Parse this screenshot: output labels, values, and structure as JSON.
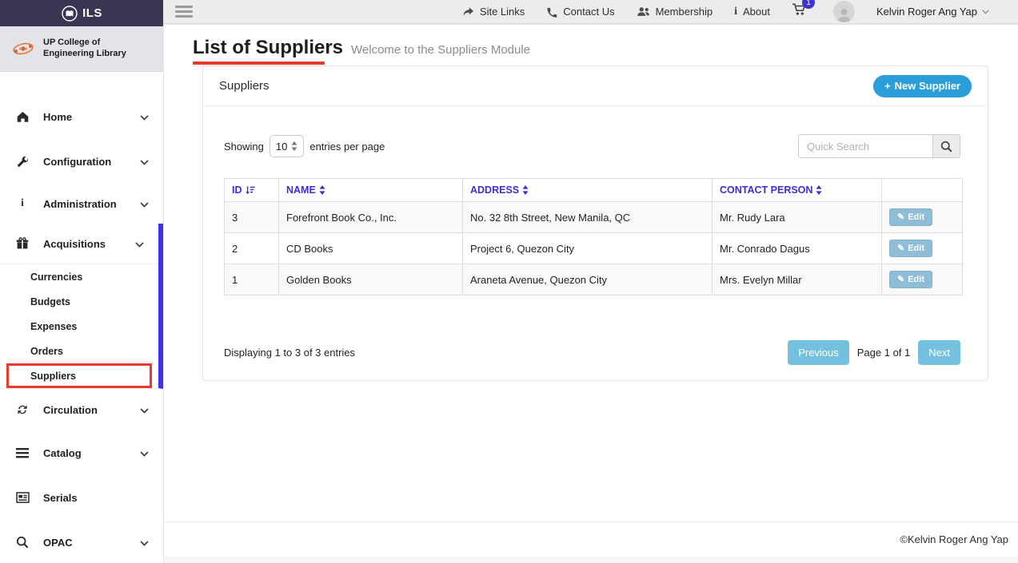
{
  "topbar": {
    "links": [
      {
        "label": "Site Links",
        "icon": "share-icon"
      },
      {
        "label": "Contact Us",
        "icon": "phone-icon"
      },
      {
        "label": "Membership",
        "icon": "users-icon"
      },
      {
        "label": "About",
        "icon": "info-icon"
      }
    ],
    "cart_badge": "1",
    "user_name": "Kelvin Roger Ang Yap"
  },
  "sidebar": {
    "app_name": "ILS",
    "library": {
      "line1": "UP College of",
      "line2": "Engineering Library"
    },
    "items": [
      {
        "label": "Home"
      },
      {
        "label": "Configuration"
      },
      {
        "label": "Administration"
      },
      {
        "label": "Acquisitions"
      },
      {
        "label": "Circulation"
      },
      {
        "label": "Catalog"
      },
      {
        "label": "Serials"
      },
      {
        "label": "OPAC"
      }
    ],
    "submenu": [
      "Currencies",
      "Budgets",
      "Expenses",
      "Orders",
      "Suppliers"
    ]
  },
  "page": {
    "title": "List of Suppliers",
    "subtitle": "Welcome to the Suppliers Module"
  },
  "panel": {
    "title": "Suppliers",
    "new_supplier_label": "New Supplier",
    "showing_label": "Showing",
    "entries_value": "10",
    "entries_suffix": "entries per page",
    "search_placeholder": "Quick Search",
    "table": {
      "headers": [
        "ID",
        "NAME",
        "ADDRESS",
        "CONTACT PERSON"
      ],
      "rows": [
        {
          "id": "3",
          "name": "Forefront Book Co., Inc.",
          "address": "No. 32 8th Street, New Manila, QC",
          "contact": "Mr. Rudy Lara",
          "action": "Edit"
        },
        {
          "id": "2",
          "name": "CD Books",
          "address": "Project 6, Quezon City",
          "contact": "Mr. Conrado Dagus",
          "action": "Edit"
        },
        {
          "id": "1",
          "name": "Golden Books",
          "address": "Araneta Avenue, Quezon City",
          "contact": "Mrs. Evelyn Millar",
          "action": "Edit"
        }
      ]
    },
    "pagination": {
      "summary": "Displaying 1 to 3 of 3 entries",
      "previous": "Previous",
      "page_info": "Page 1 of 1",
      "next": "Next"
    }
  },
  "footer": {
    "copyright": "©Kelvin Roger Ang Yap"
  },
  "icons": {
    "plus": "+",
    "pencil": "✎",
    "info": "i"
  },
  "colors": {
    "sidebar_header": "#3a3553",
    "brand_bg": "#e4e3ea",
    "accent_purple": "#4331e8",
    "table_header_text": "#3b2fd4",
    "new_button_blue": "#2b9ed9",
    "edit_button_blue": "#8fbcd6",
    "pager_blue": "#73c1de",
    "badge_indigo": "#3f33cc",
    "annotation_red": "#e83b2a",
    "topbar_bg": "#ececec"
  }
}
